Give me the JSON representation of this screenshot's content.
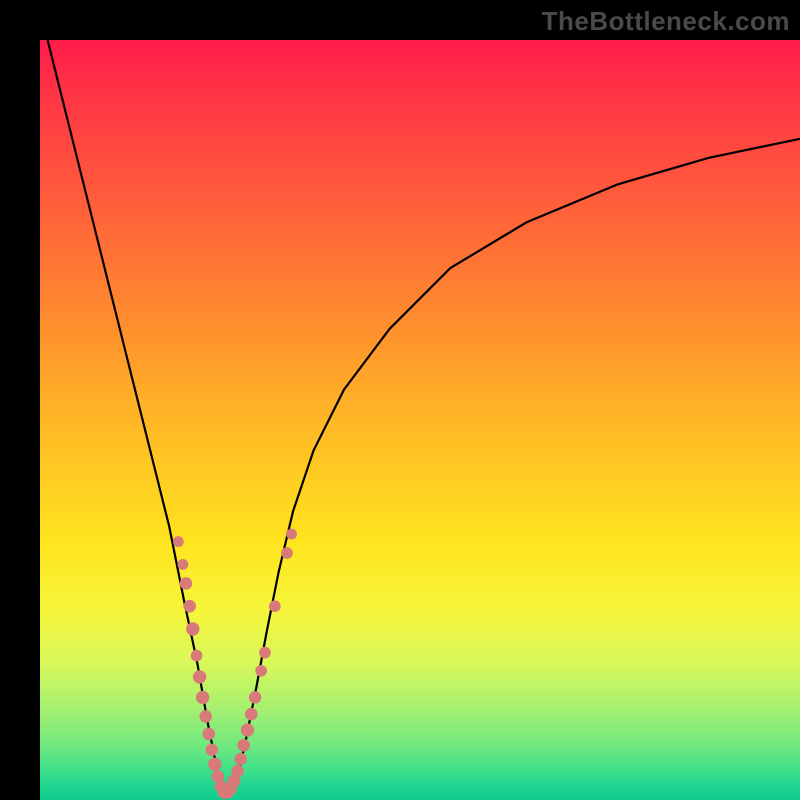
{
  "credit": "TheBottleneck.com",
  "colors": {
    "frame": "#000000",
    "curve": "#000000",
    "bead": "#d97a7a",
    "gradient_top": "#ff1a4a",
    "gradient_bottom": "#0ecc8f"
  },
  "chart_data": {
    "type": "line",
    "title": "",
    "xlabel": "",
    "ylabel": "",
    "xlim": [
      0,
      100
    ],
    "ylim": [
      0,
      100
    ],
    "description": "V-shaped bottleneck curve on a red-to-green vertical gradient background. The curve descends steeply from top-left, reaches a minimum near x≈24 at the very bottom (green zone), then rises with diminishing slope toward the top-right. Pink bead markers cluster along both branches in the lower yellow/green region near the valley.",
    "series": [
      {
        "name": "bottleneck-curve",
        "x": [
          1,
          3,
          5,
          7,
          9,
          11,
          13,
          15,
          17,
          19,
          20.7,
          22.1,
          23.3,
          24.2,
          25.1,
          26,
          27.1,
          28.5,
          29.8,
          31.4,
          33.3,
          36,
          40,
          46,
          54,
          64,
          76,
          88,
          100
        ],
        "y": [
          100,
          92,
          84,
          76,
          68,
          60,
          52,
          44,
          36,
          26,
          18,
          10,
          4,
          0.6,
          0.6,
          3,
          8,
          15,
          22,
          30,
          38,
          46,
          54,
          62,
          70,
          76,
          81,
          84.5,
          87
        ]
      }
    ],
    "markers": {
      "name": "beads",
      "points": [
        {
          "x": 18.2,
          "y": 34.0,
          "r": 1.3
        },
        {
          "x": 18.8,
          "y": 31.0,
          "r": 1.3
        },
        {
          "x": 19.2,
          "y": 28.5,
          "r": 1.5
        },
        {
          "x": 19.7,
          "y": 25.5,
          "r": 1.5
        },
        {
          "x": 20.1,
          "y": 22.5,
          "r": 1.6
        },
        {
          "x": 20.6,
          "y": 19.0,
          "r": 1.4
        },
        {
          "x": 21.0,
          "y": 16.2,
          "r": 1.6
        },
        {
          "x": 21.4,
          "y": 13.5,
          "r": 1.6
        },
        {
          "x": 21.8,
          "y": 11.0,
          "r": 1.5
        },
        {
          "x": 22.2,
          "y": 8.7,
          "r": 1.5
        },
        {
          "x": 22.6,
          "y": 6.6,
          "r": 1.5
        },
        {
          "x": 23.0,
          "y": 4.7,
          "r": 1.6
        },
        {
          "x": 23.4,
          "y": 3.1,
          "r": 1.5
        },
        {
          "x": 23.8,
          "y": 1.8,
          "r": 1.5
        },
        {
          "x": 24.2,
          "y": 1.0,
          "r": 1.5
        },
        {
          "x": 24.7,
          "y": 1.0,
          "r": 1.5
        },
        {
          "x": 25.1,
          "y": 1.5,
          "r": 1.5
        },
        {
          "x": 25.5,
          "y": 2.5,
          "r": 1.6
        },
        {
          "x": 26.0,
          "y": 3.8,
          "r": 1.5
        },
        {
          "x": 26.4,
          "y": 5.4,
          "r": 1.5
        },
        {
          "x": 26.8,
          "y": 7.2,
          "r": 1.5
        },
        {
          "x": 27.3,
          "y": 9.2,
          "r": 1.6
        },
        {
          "x": 27.8,
          "y": 11.3,
          "r": 1.5
        },
        {
          "x": 28.3,
          "y": 13.5,
          "r": 1.5
        },
        {
          "x": 29.1,
          "y": 17.0,
          "r": 1.4
        },
        {
          "x": 29.6,
          "y": 19.4,
          "r": 1.4
        },
        {
          "x": 30.9,
          "y": 25.5,
          "r": 1.4
        },
        {
          "x": 32.5,
          "y": 32.5,
          "r": 1.4
        },
        {
          "x": 33.1,
          "y": 35.0,
          "r": 1.3
        }
      ]
    }
  }
}
